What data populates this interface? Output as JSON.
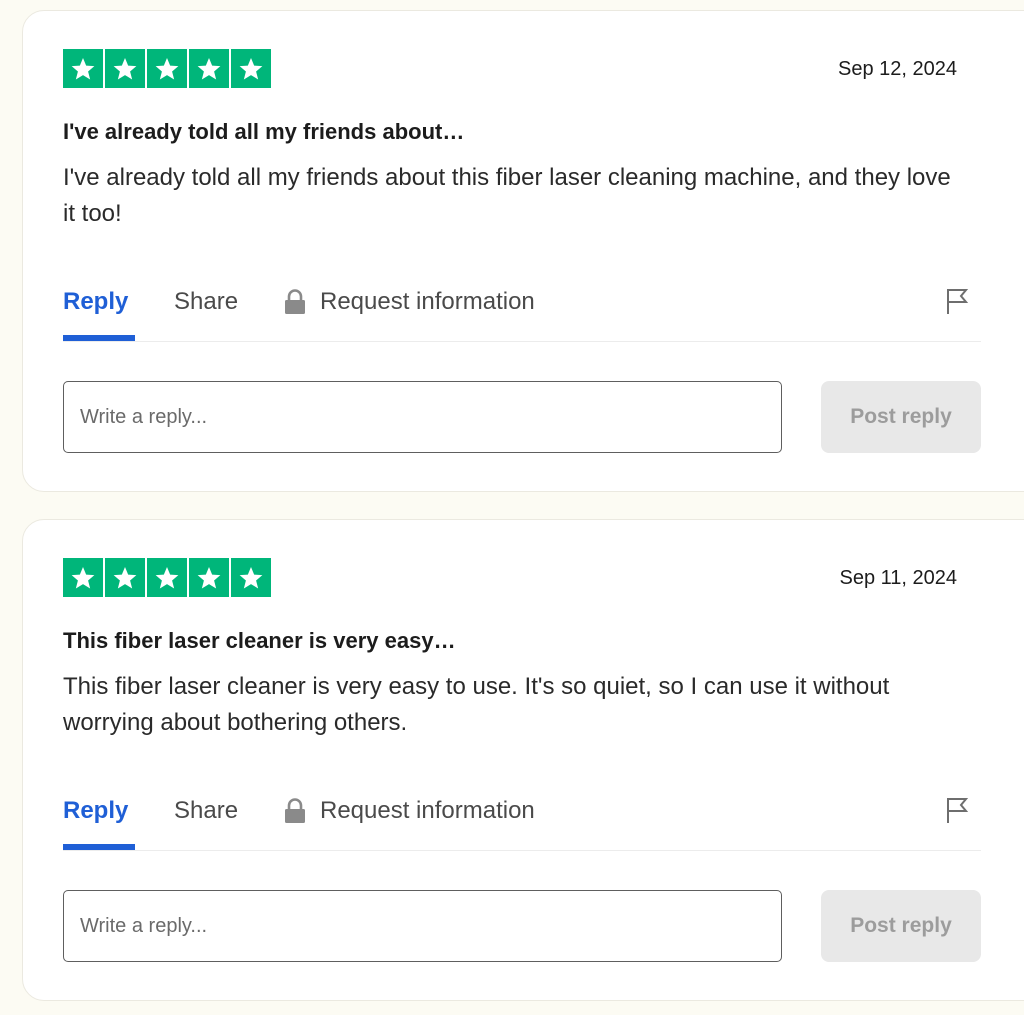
{
  "colors": {
    "star_bg": "#00b67a",
    "accent": "#1f5fd6",
    "page_bg": "#fcfbf3"
  },
  "reviews": [
    {
      "rating": 5,
      "date": "Sep 12, 2024",
      "title": "I've already told all my friends about…",
      "body": "I've already told all my friends about this fiber laser cleaning machine, and they love it too!",
      "actions": {
        "reply": "Reply",
        "share": "Share",
        "request": "Request information"
      },
      "reply_placeholder": "Write a reply...",
      "post_label": "Post reply"
    },
    {
      "rating": 5,
      "date": "Sep 11, 2024",
      "title": "This fiber laser cleaner is very easy…",
      "body": "This fiber laser cleaner is very easy to use. It's so quiet, so I can use it without worrying about bothering others.",
      "actions": {
        "reply": "Reply",
        "share": "Share",
        "request": "Request information"
      },
      "reply_placeholder": "Write a reply...",
      "post_label": "Post reply"
    }
  ],
  "icons": [
    "star-icon",
    "lock-icon",
    "flag-icon"
  ]
}
